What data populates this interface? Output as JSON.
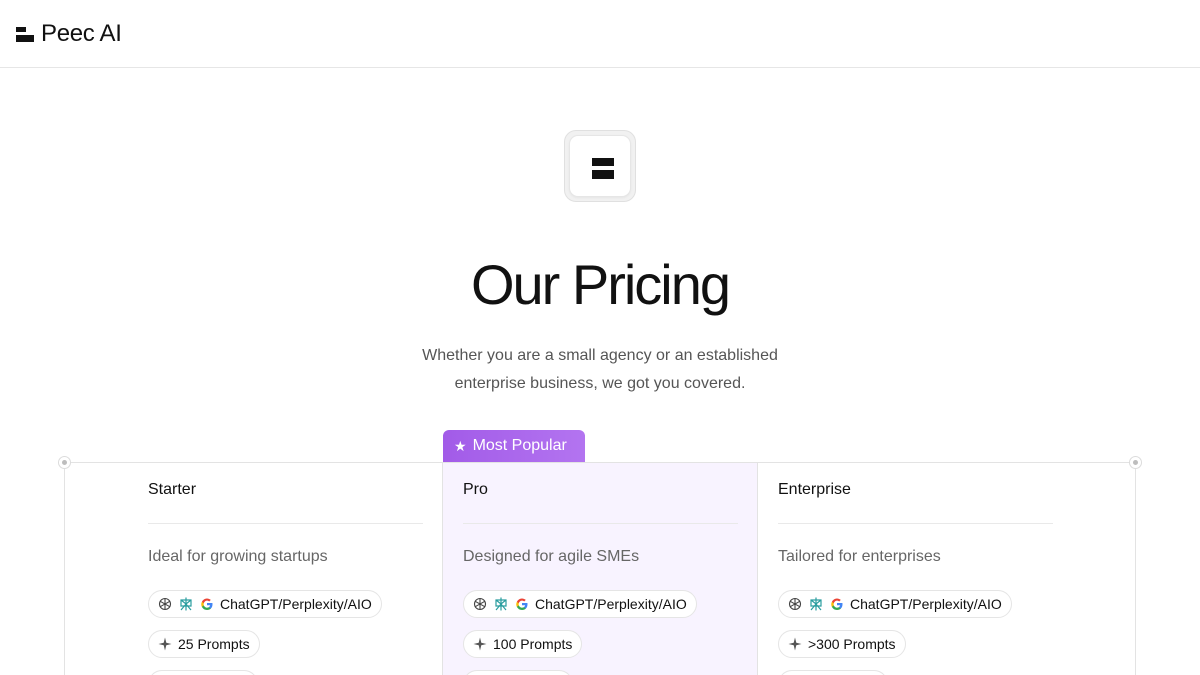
{
  "header": {
    "brand": "Peec AI"
  },
  "hero": {
    "title": "Our Pricing",
    "subtitle_line1": "Whether you are a small agency or an established",
    "subtitle_line2": "enterprise business, we got you covered."
  },
  "badge": {
    "label": "Most Popular",
    "icon": "star-icon"
  },
  "colors": {
    "accent": "#a25be8",
    "pro_background": "#f8f3ff",
    "text": "#111111",
    "muted": "#666666"
  },
  "plans": [
    {
      "name": "Starter",
      "description": "Ideal for growing startups",
      "models_label": "ChatGPT/Perplexity/AIO",
      "prompts_label": "25 Prompts"
    },
    {
      "name": "Pro",
      "description": "Designed for agile SMEs",
      "models_label": "ChatGPT/Perplexity/AIO",
      "prompts_label": "100 Prompts"
    },
    {
      "name": "Enterprise",
      "description": "Tailored for enterprises",
      "models_label": "ChatGPT/Perplexity/AIO",
      "prompts_label": ">300 Prompts"
    }
  ],
  "icons": [
    "openai-icon",
    "perplexity-icon",
    "google-icon",
    "sparkle-icon"
  ]
}
